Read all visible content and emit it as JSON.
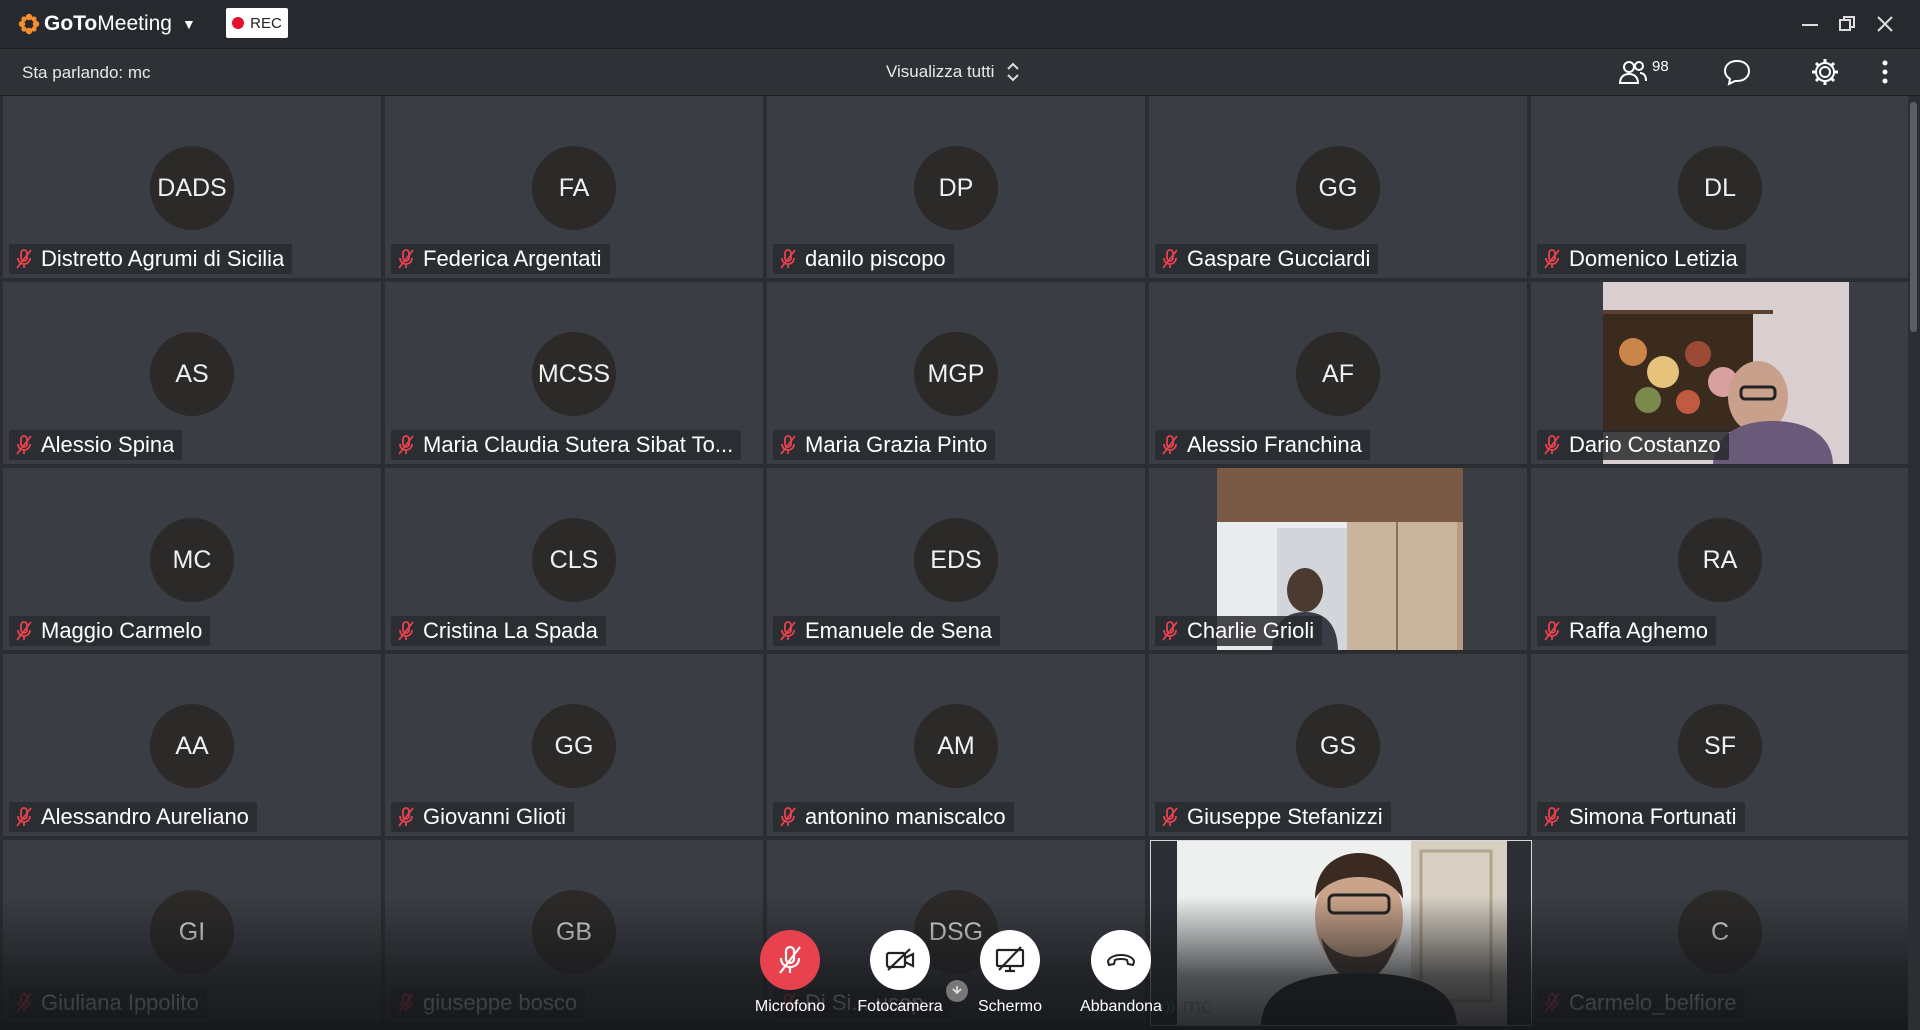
{
  "app": {
    "name_prefix": "GoTo",
    "name_suffix": "Meeting",
    "rec_label": "REC"
  },
  "toolbar": {
    "speaking": "Sta parlando: mc",
    "view_all": "Visualizza tutti",
    "participant_count": "98"
  },
  "tiles": [
    {
      "initials": "DADS",
      "name": "Distretto Agrumi di Sicilia"
    },
    {
      "initials": "FA",
      "name": "Federica Argentati"
    },
    {
      "initials": "DP",
      "name": "danilo piscopo"
    },
    {
      "initials": "GG",
      "name": "Gaspare Gucciardi"
    },
    {
      "initials": "DL",
      "name": "Domenico Letizia"
    },
    {
      "initials": "AS",
      "name": "Alessio Spina"
    },
    {
      "initials": "MCSS",
      "name": "Maria Claudia Sutera Sibat To..."
    },
    {
      "initials": "MGP",
      "name": "Maria Grazia Pinto"
    },
    {
      "initials": "AF",
      "name": "Alessio Franchina"
    },
    {
      "initials": "",
      "name": "Dario Costanzo"
    },
    {
      "initials": "MC",
      "name": "Maggio Carmelo"
    },
    {
      "initials": "CLS",
      "name": "Cristina La Spada"
    },
    {
      "initials": "EDS",
      "name": "Emanuele de Sena"
    },
    {
      "initials": "",
      "name": "Charlie Grioli"
    },
    {
      "initials": "RA",
      "name": "Raffa Aghemo"
    },
    {
      "initials": "AA",
      "name": "Alessandro Aureliano"
    },
    {
      "initials": "GG",
      "name": "Giovanni Glioti"
    },
    {
      "initials": "AM",
      "name": "antonino maniscalco"
    },
    {
      "initials": "GS",
      "name": "Giuseppe Stefanizzi"
    },
    {
      "initials": "SF",
      "name": "Simona Fortunati"
    },
    {
      "initials": "GI",
      "name": "Giuliana Ippolito"
    },
    {
      "initials": "GB",
      "name": "giuseppe bosco"
    },
    {
      "initials": "DSG",
      "name": "Di Si... usep..."
    },
    {
      "initials": "",
      "name": "mc"
    },
    {
      "initials": "C",
      "name": "Carmelo_belfiore"
    }
  ],
  "controls": {
    "mic": "Microfono",
    "camera": "Fotocamera",
    "screen": "Schermo",
    "leave": "Abbandona"
  },
  "colors": {
    "accent": "#f68d2e",
    "mute_red": "#e8424f",
    "tile_bg": "#3a3d43"
  }
}
